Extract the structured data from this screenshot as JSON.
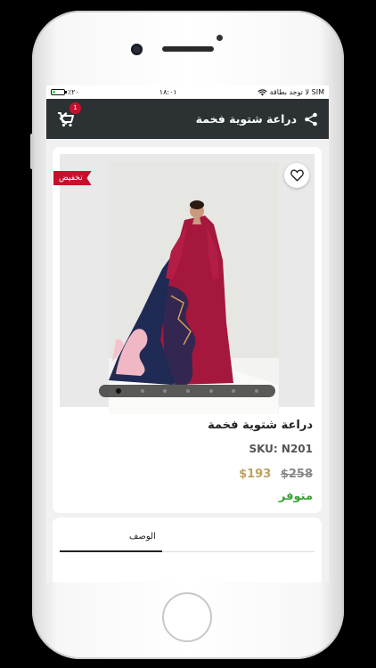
{
  "status_bar": {
    "carrier": "لا توجد بطاقة SIM",
    "time": "١٨:٠١",
    "battery": "٪٢٠"
  },
  "header": {
    "title": "دراعة شتوية فخمة",
    "cart_count": "1"
  },
  "product": {
    "sale_badge": "تخفيض",
    "name": "دراعة شتوية فخمة",
    "sku": "SKU: N201",
    "old_price": "$258",
    "new_price": "$193",
    "availability": "متوفر",
    "image_count": 7,
    "active_image": 1
  },
  "tabs": {
    "description": "الوصف"
  },
  "colors": {
    "header_bg": "#2c3134",
    "accent_red": "#c8102e",
    "price_gold": "#c0a060",
    "in_stock_green": "#3aa336"
  }
}
